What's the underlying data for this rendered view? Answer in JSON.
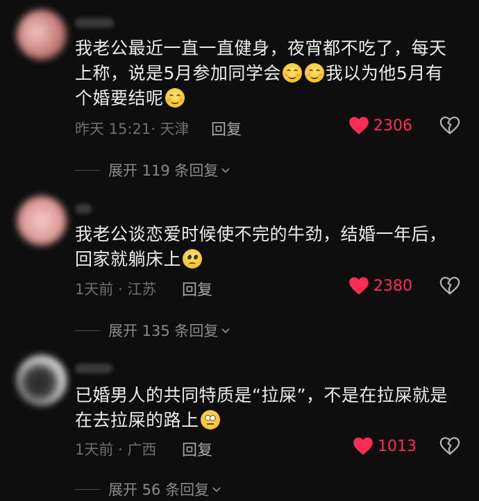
{
  "comments": [
    {
      "text_parts": [
        "我老公最近一直一直健身，夜宵都不吃了，每天上称，说是5月参加同学会",
        "我以为他5月有个婚要结呢"
      ],
      "meta": "昨天 15:21· 天津",
      "reply_label": "回复",
      "likes": "2306",
      "expand_label": "展开 119 条回复"
    },
    {
      "text_parts": [
        "我老公谈恋爱时候使不完的牛劲，结婚一年后，回家就躺床上"
      ],
      "meta": "1天前 · 江苏",
      "reply_label": "回复",
      "likes": "2380",
      "expand_label": "展开 135 条回复"
    },
    {
      "text_parts": [
        "已婚男人的共同特质是“拉屎”，不是在拉屎就是在去拉屎的路上"
      ],
      "meta": "1天前 · 广西",
      "reply_label": "回复",
      "likes": "1013",
      "expand_label": "展开 56 条回复"
    }
  ],
  "colors": {
    "like": "#ff2d55",
    "background": "#0e0e0f"
  },
  "icons": [
    "heart-icon",
    "broken-heart-icon",
    "chevron-down-icon",
    "emoji-icon"
  ]
}
